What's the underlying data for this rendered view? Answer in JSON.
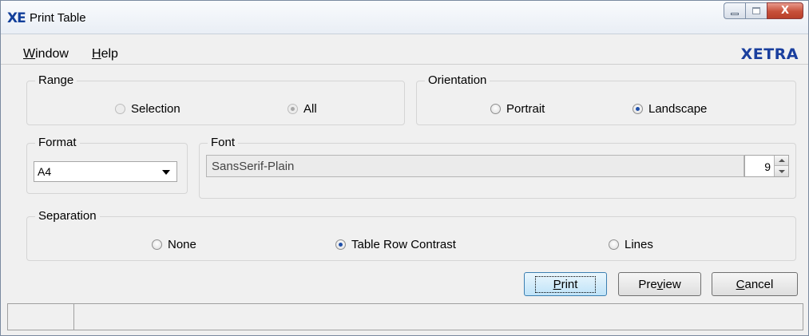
{
  "window": {
    "logo": "XE",
    "title": "Print Table",
    "close_glyph": "X",
    "icons": {
      "minimize": "minimize-icon",
      "maximize": "maximize-icon",
      "close": "close-icon"
    }
  },
  "menu": {
    "items": [
      {
        "mnemonic": "W",
        "rest": "indow"
      },
      {
        "mnemonic": "H",
        "rest": "elp"
      }
    ],
    "brand": "XETRA"
  },
  "range": {
    "legend": "Range",
    "options": [
      {
        "label": "Selection",
        "selected": false,
        "enabled": false
      },
      {
        "label": "All",
        "selected": true,
        "enabled": false
      }
    ]
  },
  "orientation": {
    "legend": "Orientation",
    "options": [
      {
        "label": "Portrait",
        "selected": false
      },
      {
        "label": "Landscape",
        "selected": true
      }
    ]
  },
  "format": {
    "legend": "Format",
    "value": "A4"
  },
  "font": {
    "legend": "Font",
    "name": "SansSerif-Plain",
    "size": "9"
  },
  "separation": {
    "legend": "Separation",
    "options": [
      {
        "label": "None",
        "selected": false
      },
      {
        "label": "Table Row Contrast",
        "selected": true
      },
      {
        "label": "Lines",
        "selected": false
      }
    ]
  },
  "buttons": {
    "print": {
      "mnemonic": "P",
      "rest": "rint"
    },
    "preview": {
      "pre": "Pre",
      "mnemonic": "v",
      "rest": "iew"
    },
    "cancel": {
      "mnemonic": "C",
      "rest": "ancel"
    }
  },
  "colors": {
    "brand": "#1a3f9e",
    "radio_selected": "#1f4fa8",
    "close_button": "#c7503a"
  }
}
